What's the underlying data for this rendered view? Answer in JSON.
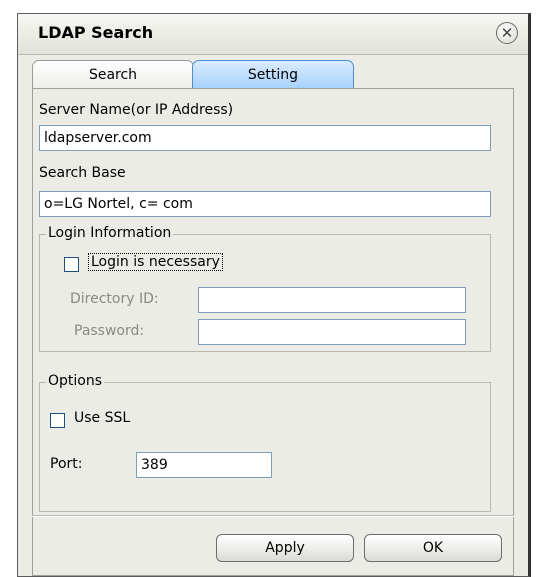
{
  "window": {
    "title": "LDAP Search"
  },
  "tabs": [
    {
      "label": "Search",
      "active": false
    },
    {
      "label": "Setting",
      "active": true
    }
  ],
  "server": {
    "label": "Server Name(or IP Address)",
    "value": "ldapserver.com"
  },
  "search_base": {
    "label": "Search Base",
    "value": "o=LG Nortel, c= com"
  },
  "login": {
    "legend": "Login Information",
    "checkbox_label": "Login is necessary",
    "checked": false,
    "directory_id_label": "Directory ID:",
    "directory_id_value": "",
    "password_label": "Password:",
    "password_value": ""
  },
  "options": {
    "legend": "Options",
    "ssl_label": "Use SSL",
    "ssl_checked": false,
    "port_label": "Port:",
    "port_value": "389"
  },
  "buttons": {
    "apply": "Apply",
    "ok": "OK"
  }
}
